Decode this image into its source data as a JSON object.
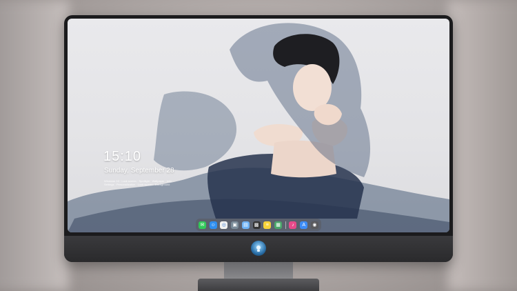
{
  "lock_screen": {
    "time": "15:10",
    "date": "Sunday, September 28",
    "notice_line_1": "Windows 10 · Lock screen · Spotlight · Wallpaper · Info",
    "notice_line_2": "Settings · Personalization · Lock screen · Background"
  },
  "dock": {
    "items": [
      {
        "name": "messages-icon",
        "color": "#33c95a",
        "glyph": "✉"
      },
      {
        "name": "finder-icon",
        "color": "#2f8ff0",
        "glyph": "☺"
      },
      {
        "name": "safari-icon",
        "color": "#f2f2f2",
        "glyph": "◎"
      },
      {
        "name": "preview-icon",
        "color": "#7a8b99",
        "glyph": "▣"
      },
      {
        "name": "folder-icon",
        "color": "#6fb3f5",
        "glyph": "▤"
      },
      {
        "name": "clapper-icon",
        "color": "#333333",
        "glyph": "▩"
      },
      {
        "name": "notes-icon",
        "color": "#f6d23a",
        "glyph": "≡"
      },
      {
        "name": "photos-icon",
        "color": "#4aa66a",
        "glyph": "▦"
      },
      {
        "name": "music-icon",
        "color": "#e84a8a",
        "glyph": "♪"
      },
      {
        "name": "app-store-icon",
        "color": "#3d8cf5",
        "glyph": "A"
      },
      {
        "name": "camera-icon",
        "color": "#5a5a5e",
        "glyph": "◉"
      }
    ]
  },
  "colors": {
    "bezel": "#1b1b1d",
    "chin": "#2f2f31",
    "screen_bg": "#e6e6e9",
    "veil": "#4b5e7a"
  }
}
